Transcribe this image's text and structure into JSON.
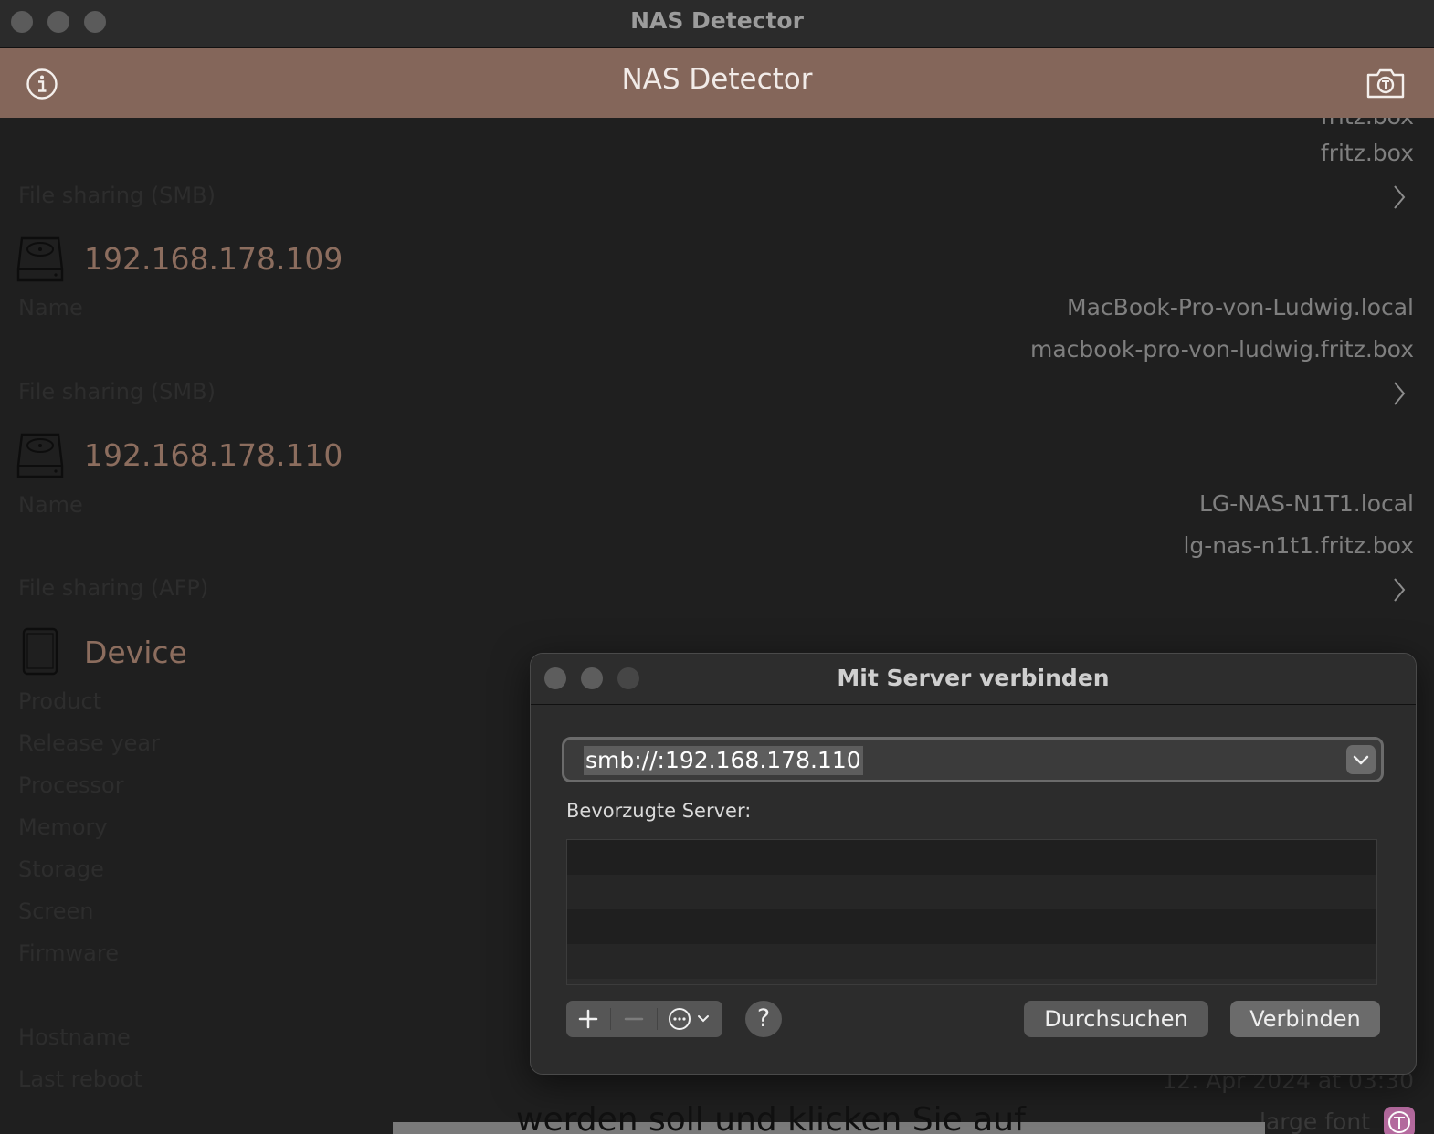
{
  "window": {
    "title": "NAS Detector"
  },
  "navbar": {
    "title": "NAS Detector",
    "info_icon": "info-icon",
    "camera_icon": "camera-icon"
  },
  "list": {
    "partial_top_value": "fritz.box",
    "entry0": {
      "hostname": "fritz.box",
      "service_label": "File sharing (SMB)"
    },
    "entry1": {
      "ip": "192.168.178.109",
      "name_label": "Name",
      "name_value": "MacBook-Pro-von-Ludwig.local",
      "host_value": "macbook-pro-von-ludwig.fritz.box",
      "service_label": "File sharing (SMB)"
    },
    "entry2": {
      "ip": "192.168.178.110",
      "name_label": "Name",
      "name_value": "LG-NAS-N1T1.local",
      "host_value": "lg-nas-n1t1.fritz.box",
      "service_label": "File sharing (AFP)"
    },
    "device": {
      "title": "Device",
      "labels": [
        "Product",
        "Release year",
        "Processor",
        "Memory",
        "Storage",
        "Screen",
        "Firmware",
        "Hostname",
        "Last reboot"
      ],
      "last_reboot_value": "12. Apr 2024 at 03:30",
      "partial_large_font": "large font"
    }
  },
  "background_text": "werden soll und klicken Sie auf",
  "dialog": {
    "title": "Mit Server verbinden",
    "url_value": "smb://:192.168.178.110",
    "favorites_label": "Bevorzugte Server:",
    "favorites": [],
    "browse_label": "Durchsuchen",
    "connect_label": "Verbinden",
    "help_label": "?"
  }
}
